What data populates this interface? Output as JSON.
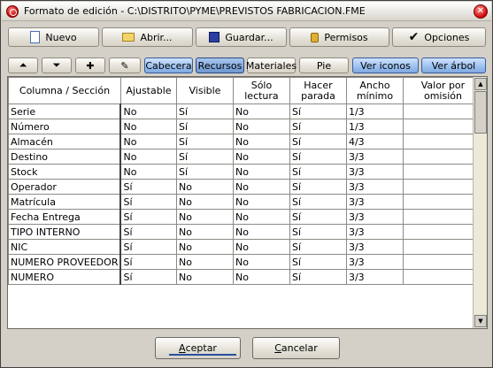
{
  "window": {
    "title": "Formato de edición - C:\\DISTRITO\\PYME\\PREVISTOS FABRICACION.FME",
    "close_glyph": "✕"
  },
  "toolbar": {
    "nuevo": "Nuevo",
    "abrir": "Abrir...",
    "guardar": "Guardar...",
    "permisos": "Permisos",
    "opciones": "Opciones"
  },
  "tabs": {
    "up_glyph": "⏶",
    "down_glyph": "⏷",
    "add_glyph": "✚",
    "clear_glyph": "✎",
    "cabecera": "Cabecera",
    "recursos": "Recursos",
    "materiales": "Materiales",
    "pie": "Pie",
    "ver_iconos": "Ver iconos",
    "ver_arbol": "Ver árbol"
  },
  "grid": {
    "headers": [
      "Columna / Sección",
      "Ajustable",
      "Visible",
      "Sólo lectura",
      "Hacer parada",
      "Ancho mínimo",
      "Valor por omisión"
    ],
    "rows": [
      [
        "Serie",
        "No",
        "Sí",
        "No",
        "Sí",
        "1/3",
        ""
      ],
      [
        "Número",
        "No",
        "Sí",
        "No",
        "Sí",
        "1/3",
        ""
      ],
      [
        "Almacén",
        "No",
        "Sí",
        "No",
        "Sí",
        "4/3",
        ""
      ],
      [
        "Destino",
        "No",
        "Sí",
        "No",
        "Sí",
        "3/3",
        ""
      ],
      [
        "Stock",
        "No",
        "Sí",
        "No",
        "Sí",
        "3/3",
        ""
      ],
      [
        "Operador",
        "Sí",
        "No",
        "No",
        "Sí",
        "3/3",
        ""
      ],
      [
        "Matrícula",
        "Sí",
        "No",
        "No",
        "Sí",
        "3/3",
        ""
      ],
      [
        "Fecha Entrega",
        "Sí",
        "No",
        "No",
        "Sí",
        "3/3",
        ""
      ],
      [
        "TIPO INTERNO",
        "Sí",
        "No",
        "No",
        "Sí",
        "3/3",
        ""
      ],
      [
        "NIC",
        "Sí",
        "No",
        "No",
        "Sí",
        "3/3",
        ""
      ],
      [
        "NUMERO PROVEEDOR",
        "Sí",
        "No",
        "No",
        "Sí",
        "3/3",
        ""
      ],
      [
        "NUMERO",
        "Sí",
        "No",
        "No",
        "Sí",
        "3/3",
        ""
      ]
    ]
  },
  "footer": {
    "aceptar_first": "A",
    "aceptar_rest": "ceptar",
    "cancelar_first": "C",
    "cancelar_rest": "ancelar"
  },
  "scroll": {
    "up_glyph": "▲",
    "down_glyph": "▼"
  }
}
